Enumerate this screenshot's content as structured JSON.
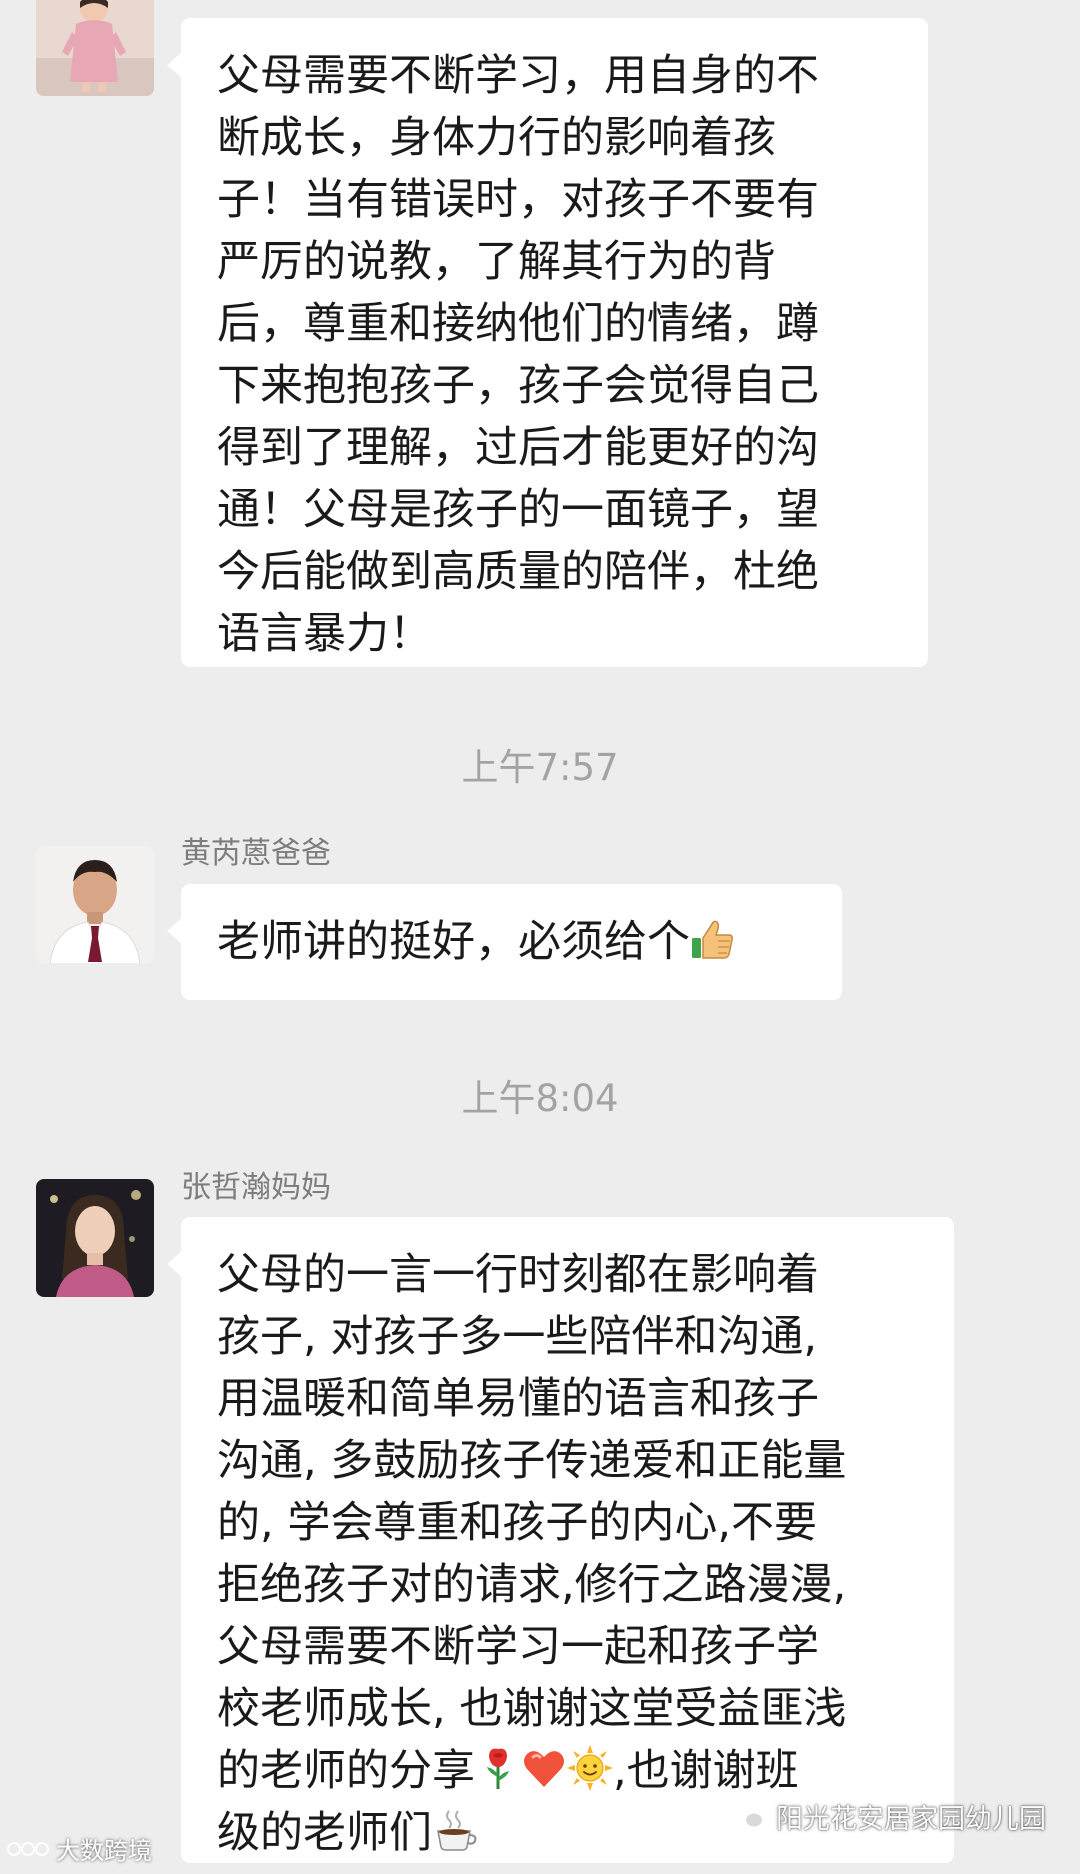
{
  "messages": [
    {
      "sender": "",
      "lines": [
        "父母需要不断学习，用自身的不",
        "断成长，身体力行的影响着孩",
        "子！当有错误时，对孩子不要有",
        "严厉的说教，了解其行为的背",
        "后，尊重和接纳他们的情绪，蹲",
        "下来抱抱孩子，孩子会觉得自己",
        "得到了理解，过后才能更好的沟",
        "通！父母是孩子的一面镜子，望",
        "今后能做到高质量的陪伴，杜绝",
        "语言暴力！"
      ]
    },
    {
      "timestamp": "上午7:57",
      "sender": "黄芮蒽爸爸",
      "text": "老师讲的挺好，必须给个",
      "emoji": "thumbs-up"
    },
    {
      "timestamp": "上午8:04",
      "sender": "张哲瀚妈妈",
      "lines": [
        "父母的一言一行时刻都在影响着",
        "孩子, 对孩子多一些陪伴和沟通,",
        "用温暖和简单易懂的语言和孩子",
        "沟通, 多鼓励孩子传递爱和正能量",
        "的, 学会尊重和孩子的内心,不要",
        "拒绝孩子对的请求,修行之路漫漫,",
        "父母需要不断学习一起和孩子学",
        "校老师成长, 也谢谢这堂受益匪浅"
      ],
      "line9_prefix": "的老师的分享",
      "line9_suffix": ",也谢谢班",
      "line10_prefix": "级的老师们",
      "emojis": [
        "rose",
        "red-heart",
        "sun-with-face",
        "hot-beverage"
      ]
    }
  ],
  "watermark": {
    "account": "阳光花安居家园幼儿园",
    "source": "大数跨境"
  },
  "colors": {
    "background": "#ededed",
    "bubble": "#ffffff",
    "sender_name": "#7d7d7d",
    "timestamp": "#a3a3a3"
  }
}
